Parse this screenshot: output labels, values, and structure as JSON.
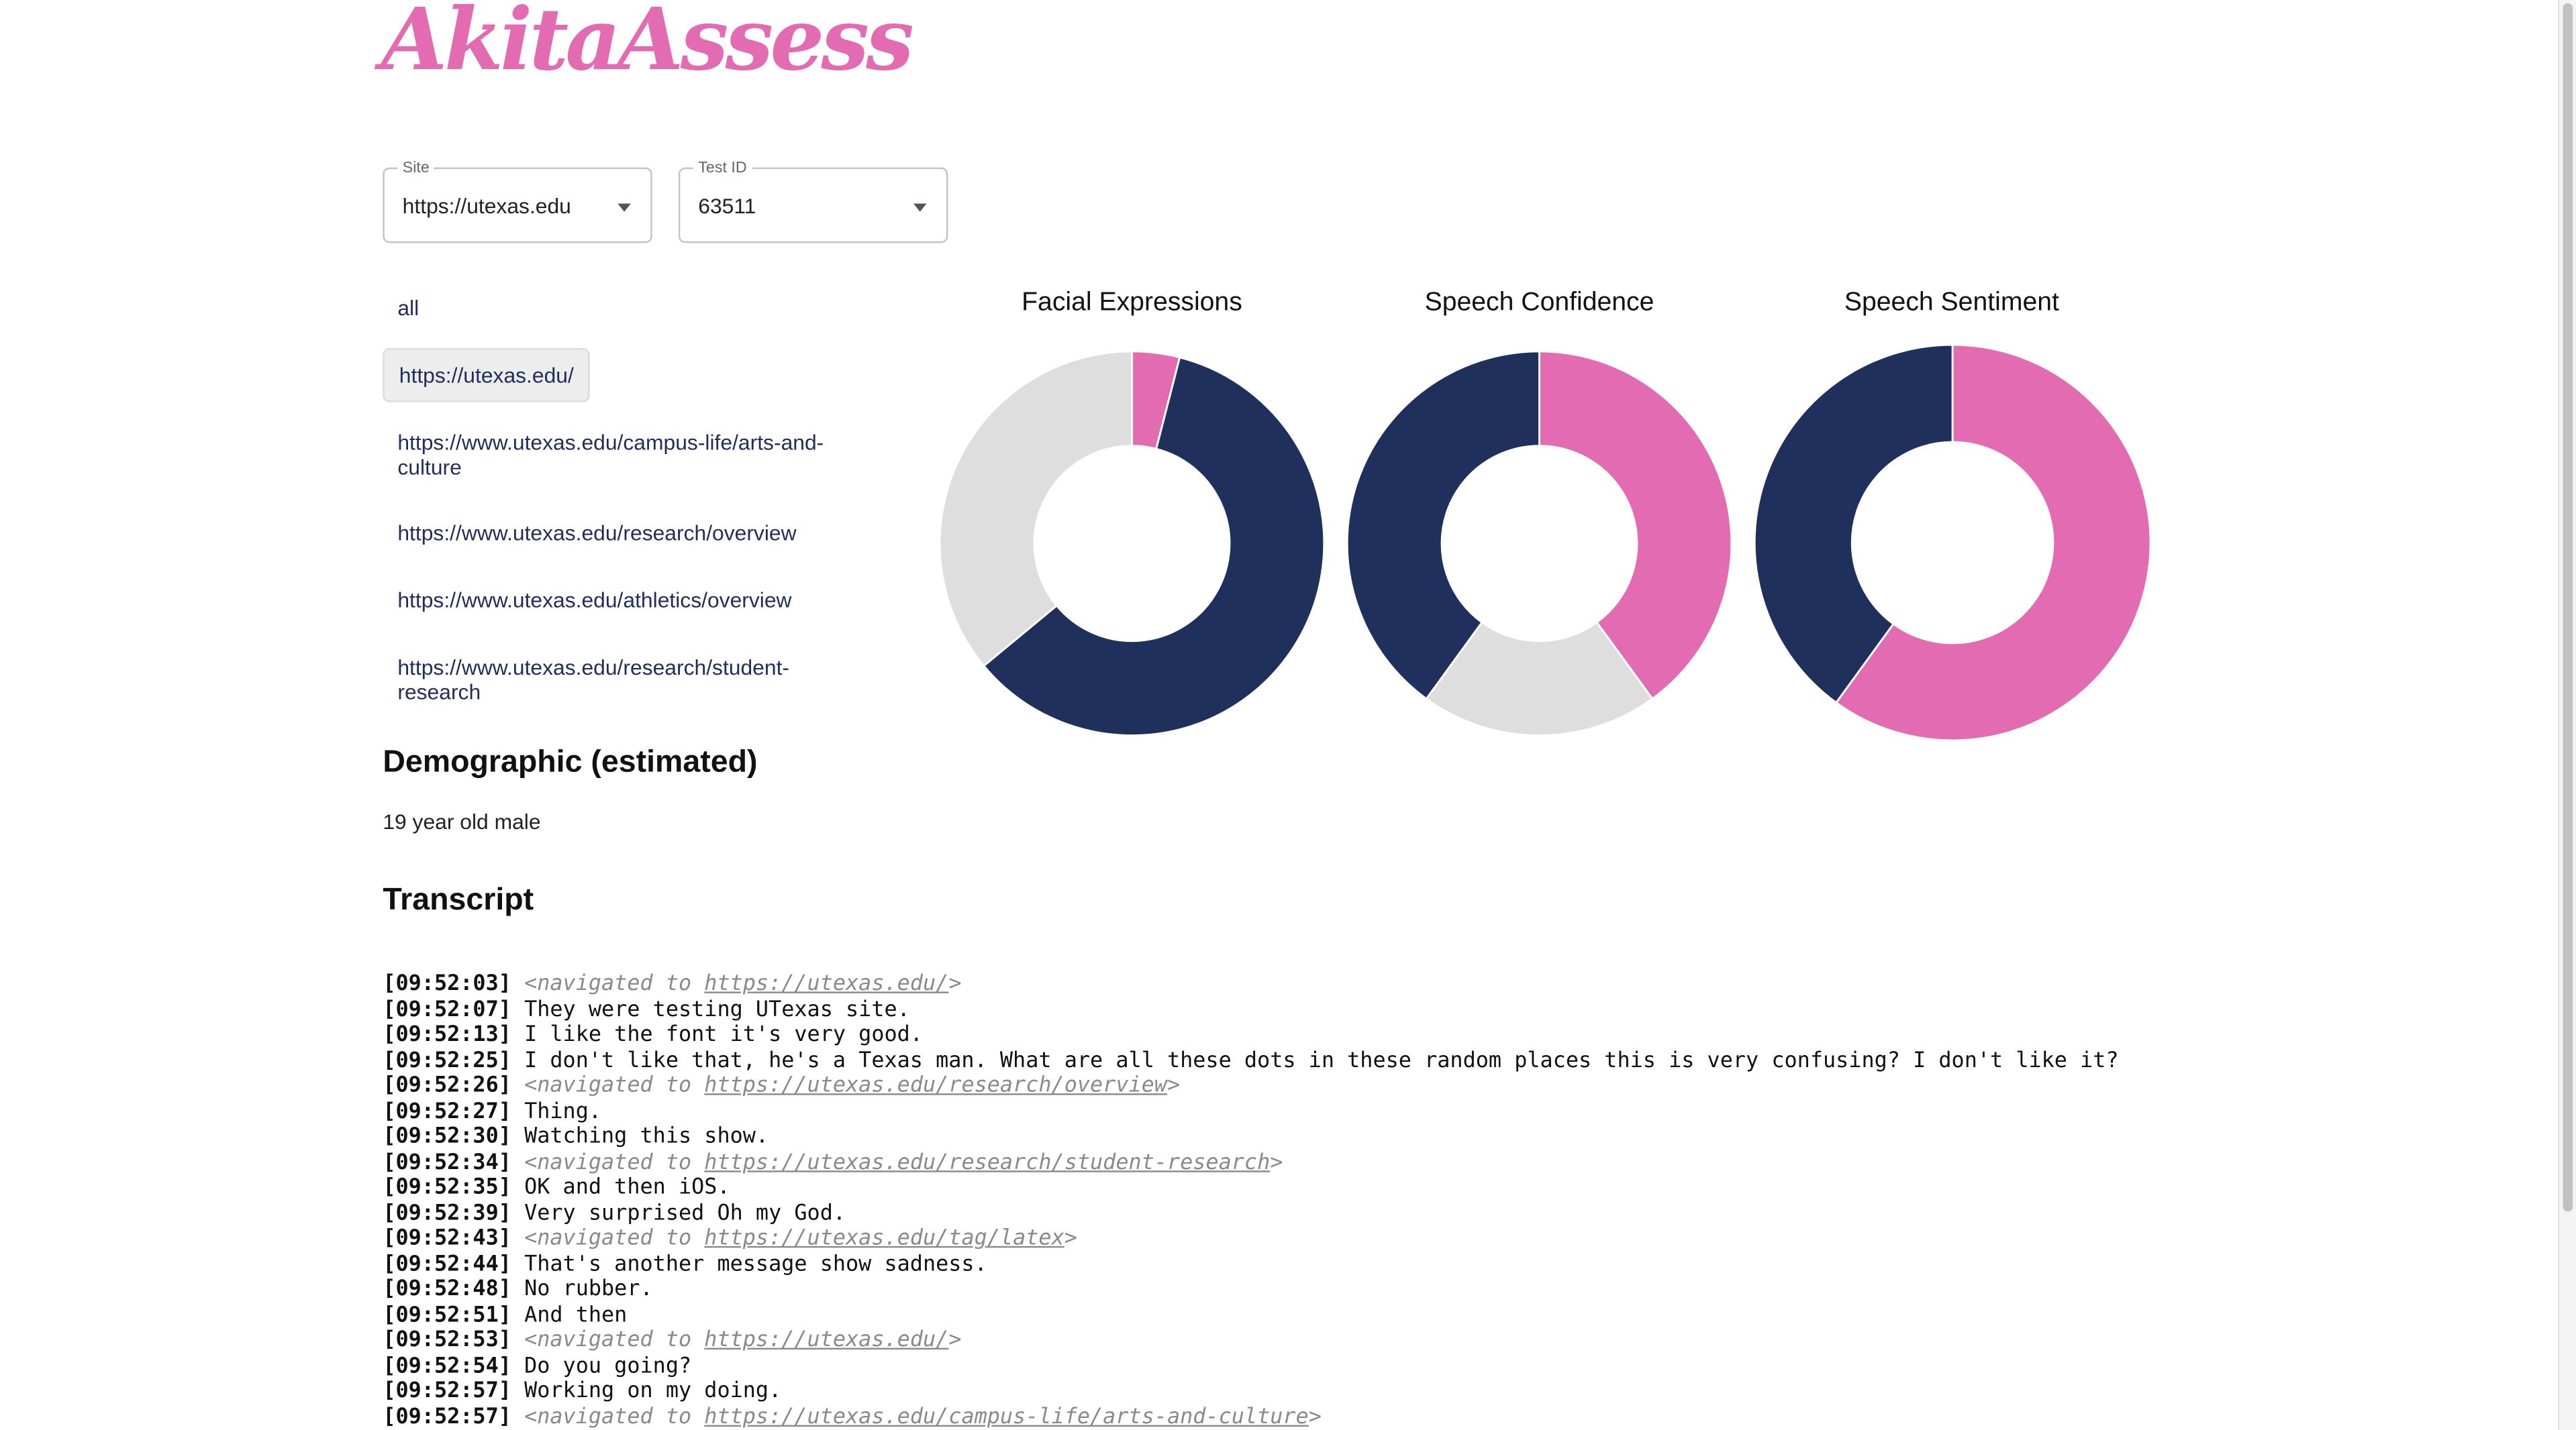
{
  "app": {
    "logo_text": "AkitaAssess"
  },
  "filters": {
    "site": {
      "label": "Site",
      "value": "https://utexas.edu"
    },
    "test_id": {
      "label": "Test ID",
      "value": "63511"
    }
  },
  "pages": {
    "items": [
      {
        "label": "all",
        "active": false
      },
      {
        "label": "https://utexas.edu/",
        "active": true
      },
      {
        "label": "https://www.utexas.edu/campus-life/arts-and-culture",
        "active": false
      },
      {
        "label": "https://www.utexas.edu/research/overview",
        "active": false
      },
      {
        "label": "https://www.utexas.edu/athletics/overview",
        "active": false
      },
      {
        "label": "https://www.utexas.edu/research/student-research",
        "active": false
      }
    ]
  },
  "colors": {
    "pink": "#e26bb2",
    "navy": "#20305c",
    "light_gray": "#dedede",
    "accent": "#e26bb2"
  },
  "chart_data": [
    {
      "type": "pie",
      "title": "Facial Expressions",
      "values": [
        4,
        60,
        36
      ],
      "colors": [
        "#e26bb2",
        "#20305c",
        "#dedede"
      ]
    },
    {
      "type": "pie",
      "title": "Speech Confidence",
      "values": [
        40,
        20,
        40
      ],
      "colors": [
        "#e26bb2",
        "#dedede",
        "#20305c"
      ]
    },
    {
      "type": "pie",
      "title": "Speech Sentiment",
      "values": [
        60,
        40
      ],
      "colors": [
        "#e26bb2",
        "#20305c"
      ]
    }
  ],
  "demographic": {
    "heading": "Demographic (estimated)",
    "text": "19 year old male"
  },
  "transcript": {
    "heading": "Transcript",
    "nav_prefix": "<navigated to ",
    "nav_suffix": ">",
    "lines": [
      {
        "time": "[09:52:03]",
        "url": "https://utexas.edu/"
      },
      {
        "time": "[09:52:07]",
        "text": "They were testing UTexas site."
      },
      {
        "time": "[09:52:13]",
        "text": "I like the font it's very good."
      },
      {
        "time": "[09:52:25]",
        "text": "I don't like that, he's a Texas man. What are all these dots in these random places this is very confusing? I don't like it?"
      },
      {
        "time": "[09:52:26]",
        "url": "https://utexas.edu/research/overview"
      },
      {
        "time": "[09:52:27]",
        "text": "Thing."
      },
      {
        "time": "[09:52:30]",
        "text": "Watching this show."
      },
      {
        "time": "[09:52:34]",
        "url": "https://utexas.edu/research/student-research"
      },
      {
        "time": "[09:52:35]",
        "text": "OK and then iOS."
      },
      {
        "time": "[09:52:39]",
        "text": "Very surprised Oh my God."
      },
      {
        "time": "[09:52:43]",
        "url": "https://utexas.edu/tag/latex"
      },
      {
        "time": "[09:52:44]",
        "text": "That's another message show sadness."
      },
      {
        "time": "[09:52:48]",
        "text": "No rubber."
      },
      {
        "time": "[09:52:51]",
        "text": "And then"
      },
      {
        "time": "[09:52:53]",
        "url": "https://utexas.edu/"
      },
      {
        "time": "[09:52:54]",
        "text": "Do you going?"
      },
      {
        "time": "[09:52:57]",
        "text": "Working on my doing."
      },
      {
        "time": "[09:52:57]",
        "url": "https://utexas.edu/campus-life/arts-and-culture"
      }
    ]
  }
}
